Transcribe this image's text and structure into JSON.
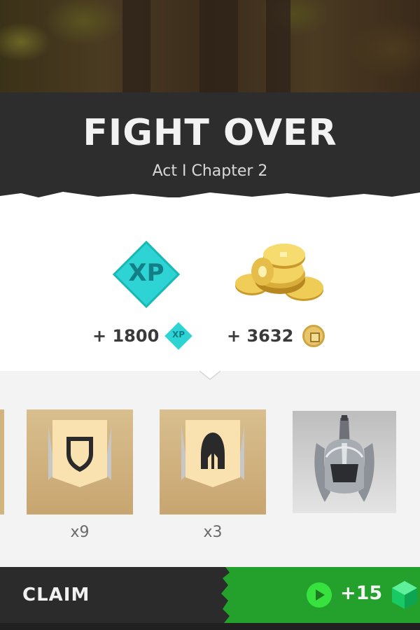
{
  "header": {
    "title": "FIGHT OVER",
    "subtitle": "Act I Chapter 2"
  },
  "rewards": {
    "xp": {
      "icon": "xp-diamond-icon",
      "badge_text": "XP",
      "amount": "+ 1800",
      "mini_badge_text": "XP"
    },
    "coins": {
      "icon": "gold-coins-pile-icon",
      "amount": "+ 3632",
      "mini_icon": "coin-icon"
    }
  },
  "items": [
    {
      "icon": "shield-banner-icon",
      "count": "x9"
    },
    {
      "icon": "helmet-banner-icon",
      "count": "x3"
    },
    {
      "icon": "spiked-helmet-icon",
      "count": ""
    }
  ],
  "footer": {
    "claim_label": "CLAIM",
    "video_icon": "play-icon",
    "video_reward": "+15",
    "video_reward_icon": "green-gem-icon"
  },
  "colors": {
    "header_bg": "#2d2d2d",
    "xp_accent": "#2ed3d3",
    "item_card": "#d2b47f",
    "video_button": "#23a12c"
  }
}
